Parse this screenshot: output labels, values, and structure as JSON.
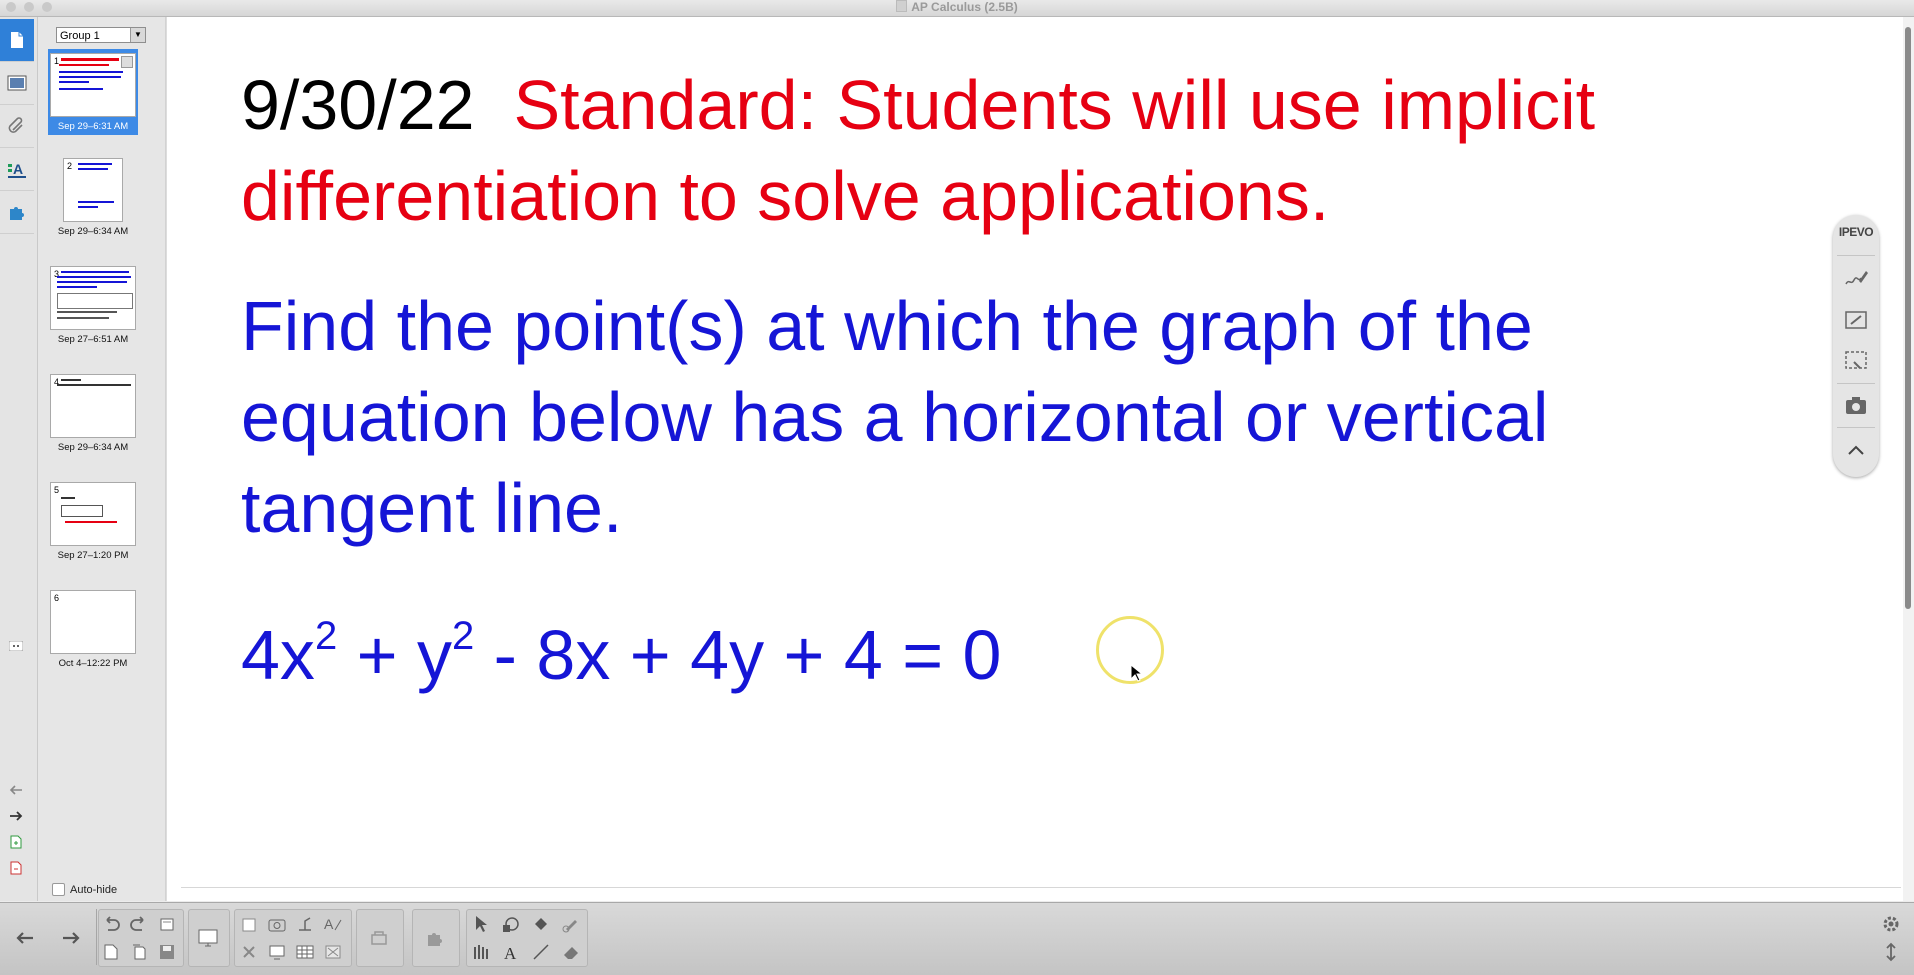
{
  "window": {
    "title": "AP Calculus (2.5B)"
  },
  "left_tabs": [
    {
      "name": "page-sorter-icon"
    },
    {
      "name": "gallery-icon"
    },
    {
      "name": "attachments-icon"
    },
    {
      "name": "properties-icon"
    },
    {
      "name": "addons-icon"
    }
  ],
  "sorter": {
    "group": "Group 1",
    "autohide_label": "Auto-hide",
    "pages": [
      {
        "num": "1",
        "date": "Sep 29–6:31 AM",
        "selected": true
      },
      {
        "num": "2",
        "date": "Sep 29–6:34 AM"
      },
      {
        "num": "3",
        "date": "Sep 27–6:51 AM"
      },
      {
        "num": "4",
        "date": "Sep 29–6:34 AM"
      },
      {
        "num": "5",
        "date": "Sep 27–1:20 PM"
      },
      {
        "num": "6",
        "date": "Oct 4–12:22 PM"
      }
    ]
  },
  "slide": {
    "date": "9/30/22",
    "standard_line1": "Standard: Students will use implicit",
    "standard_line2": "differentiation to solve applications.",
    "problem_line1": "Find the point(s) at which the graph of the",
    "problem_line2": "equation below has a horizontal or vertical",
    "problem_line3": "tangent line.",
    "equation": {
      "a": "4x",
      "exp1": "2",
      "b": " + y",
      "exp2": "2",
      "c": " - 8x + 4y + 4 = 0"
    }
  },
  "ipevo": {
    "label": "IPEVO"
  },
  "colors": {
    "red": "#e60012",
    "blue": "#1515d6",
    "selected_tab": "#2f80d8"
  }
}
